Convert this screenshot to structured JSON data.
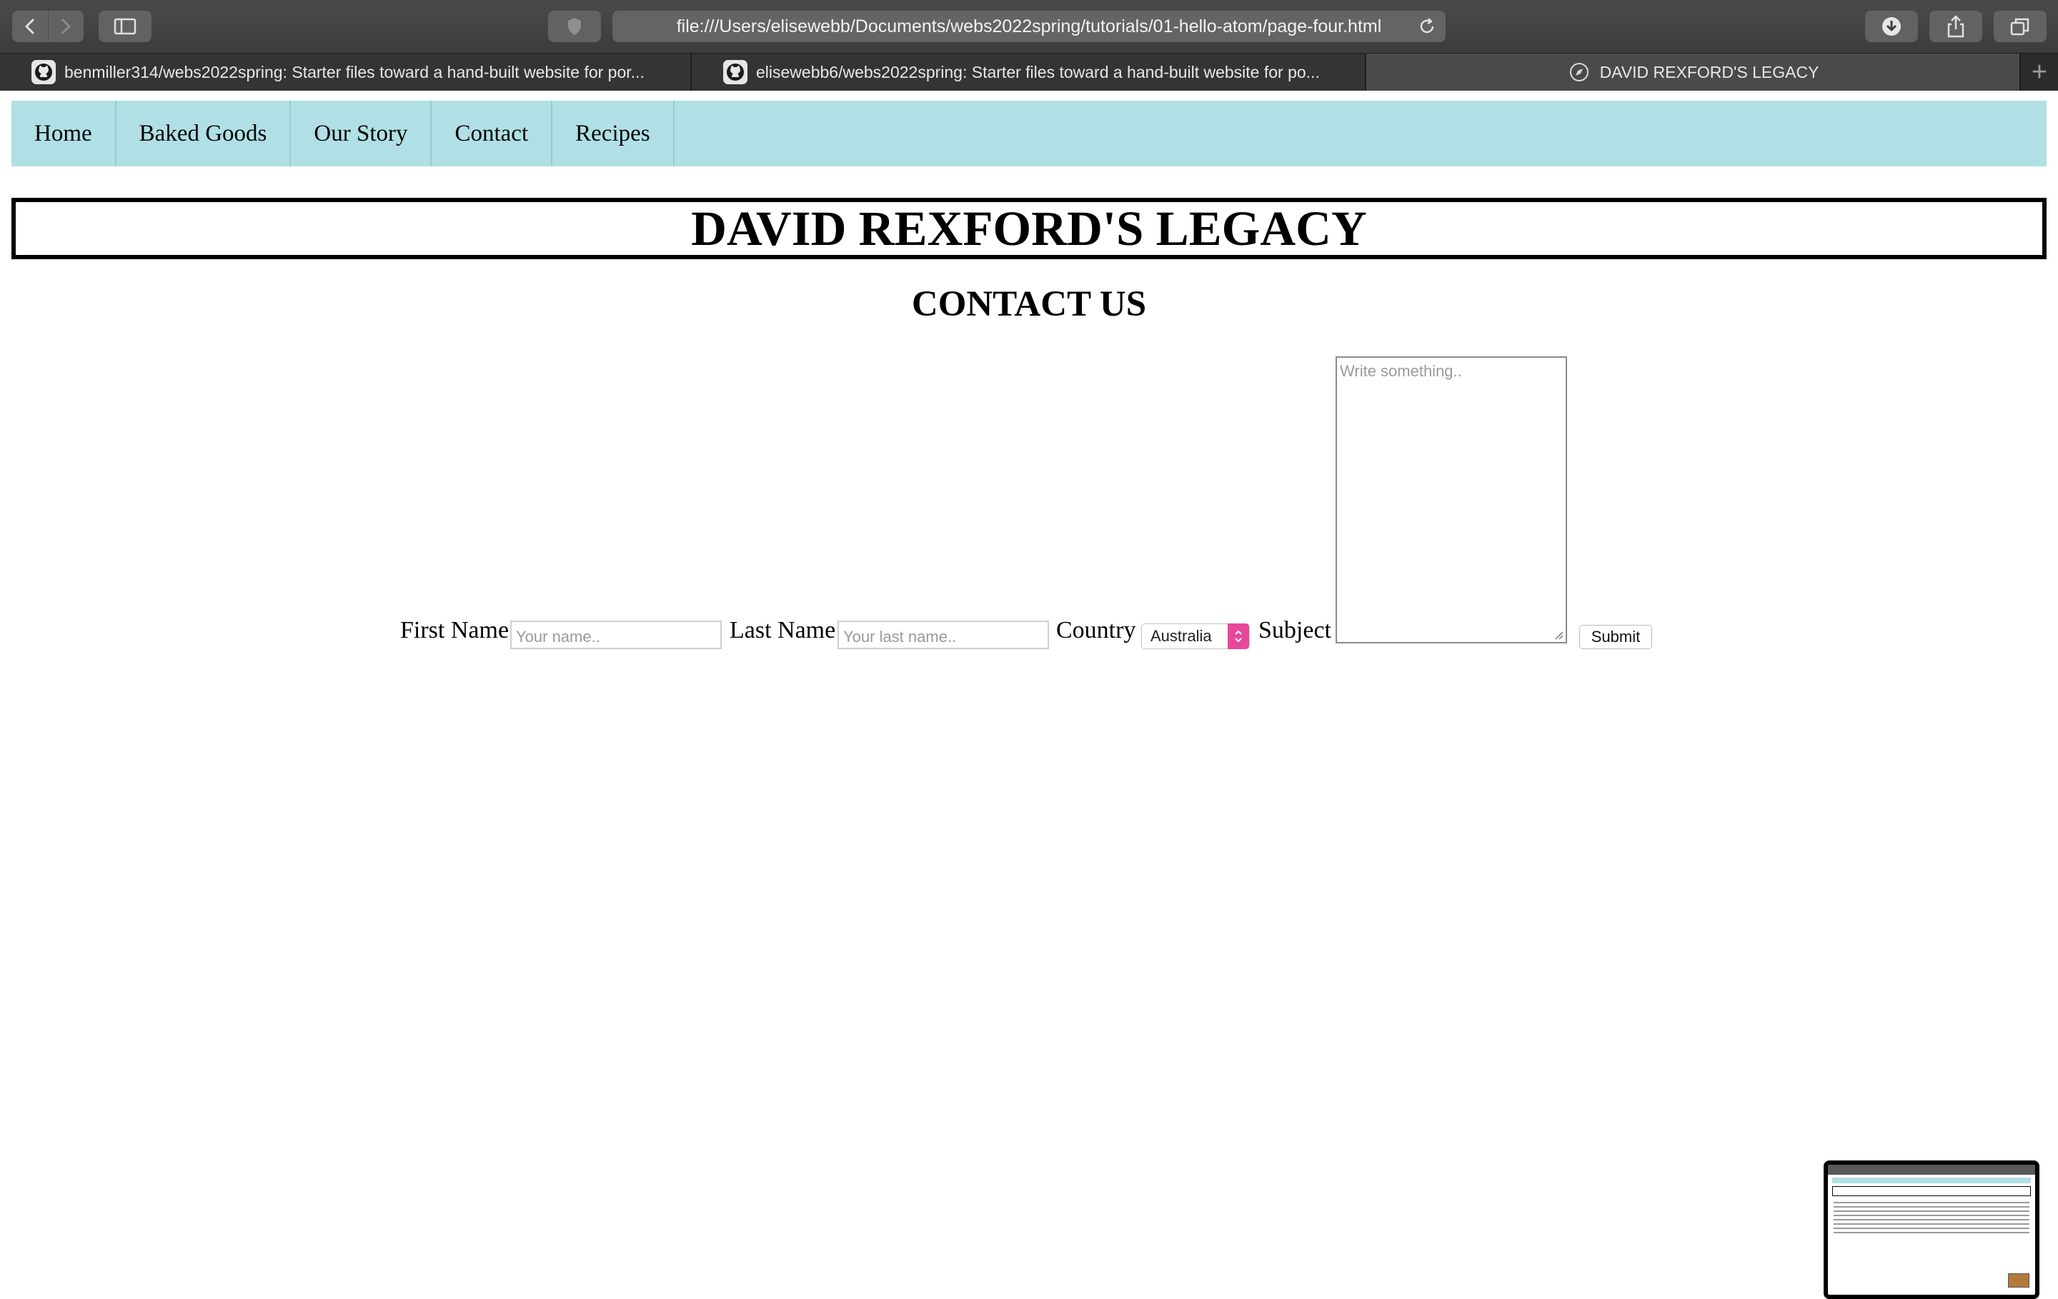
{
  "browser": {
    "url": "file:///Users/elisewebb/Documents/webs2022spring/tutorials/01-hello-atom/page-four.html",
    "tabs": [
      {
        "label": "benmiller314/webs2022spring: Starter files toward a hand-built website for por...",
        "icon": "github-icon",
        "active": false
      },
      {
        "label": "elisewebb6/webs2022spring: Starter files toward a hand-built website for po...",
        "icon": "github-icon",
        "active": false
      },
      {
        "label": "DAVID REXFORD'S LEGACY",
        "icon": "compass-icon",
        "active": true
      }
    ],
    "new_tab": "+"
  },
  "nav": {
    "items": [
      "Home",
      "Baked Goods",
      "Our Story",
      "Contact",
      "Recipes"
    ]
  },
  "banner": {
    "title": "DAVID REXFORD'S LEGACY"
  },
  "contact": {
    "title": "CONTACT US",
    "first_name_label": "First Name",
    "first_name_placeholder": "Your name..",
    "last_name_label": "Last Name",
    "last_name_placeholder": "Your last name..",
    "country_label": "Country",
    "country_value": "Australia",
    "subject_label": "Subject",
    "subject_placeholder": "Write something..",
    "submit_label": "Submit"
  },
  "colors": {
    "nav_bg": "#b0dfe5",
    "select_accent": "#e8489b",
    "chrome_bg": "#3c3c3c"
  }
}
